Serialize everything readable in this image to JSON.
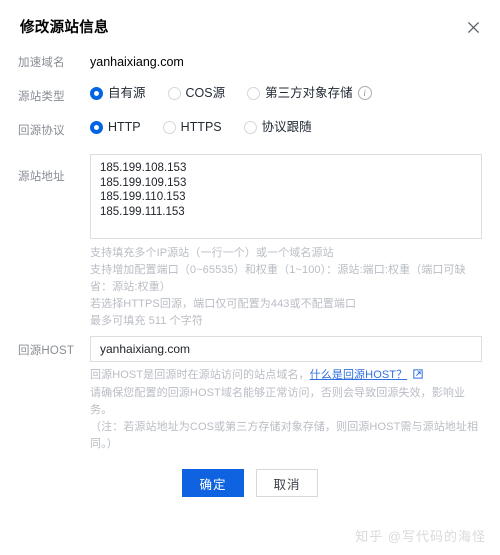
{
  "dialog": {
    "title": "修改源站信息",
    "close_icon": "close-icon"
  },
  "fields": {
    "domain": {
      "label": "加速域名",
      "value": "yanhaixiang.com"
    },
    "origin_type": {
      "label": "源站类型",
      "options": [
        {
          "label": "自有源",
          "checked": true
        },
        {
          "label": "COS源",
          "checked": false
        },
        {
          "label": "第三方对象存储",
          "checked": false
        }
      ],
      "info_icon": "info-circle-icon"
    },
    "origin_protocol": {
      "label": "回源协议",
      "options": [
        {
          "label": "HTTP",
          "checked": true
        },
        {
          "label": "HTTPS",
          "checked": false
        },
        {
          "label": "协议跟随",
          "checked": false
        }
      ]
    },
    "origin_address": {
      "label": "源站地址",
      "value": "185.199.108.153\n185.199.109.153\n185.199.110.153\n185.199.111.153",
      "placeholder": "",
      "helper_lines": [
        "支持填充多个IP源站（一行一个）或一个域名源站",
        "支持增加配置端口（0~65535）和权重（1~100）：源站:端口:权重（端口可缺省：源站:权重）",
        "若选择HTTPS回源，端口仅可配置为443或不配置端口",
        "最多可填充 511 个字符"
      ]
    },
    "origin_host": {
      "label": "回源HOST",
      "value": "yanhaixiang.com",
      "placeholder": "",
      "helper_prefix": "回源HOST是回源时在源站访问的站点域名，",
      "helper_link": "什么是回源HOST？",
      "helper_link_icon": "external-link-icon",
      "helper_line_2": "请确保您配置的回源HOST域名能够正常访问，否则会导致回源失效，影响业务。",
      "helper_line_3": "（注：若源站地址为COS或第三方存储对象存储，则回源HOST需与源站地址相同。）"
    }
  },
  "footer": {
    "confirm_label": "确定",
    "cancel_label": "取消"
  },
  "watermark": {
    "text": "知乎 @写代码的海怪"
  },
  "colors": {
    "accent": "#1063e0",
    "radio_checked": "#0165e1",
    "link": "#2f6fe0",
    "helper_text": "#b9bdc4",
    "label_text": "#888d94",
    "border": "#dcdee2"
  }
}
